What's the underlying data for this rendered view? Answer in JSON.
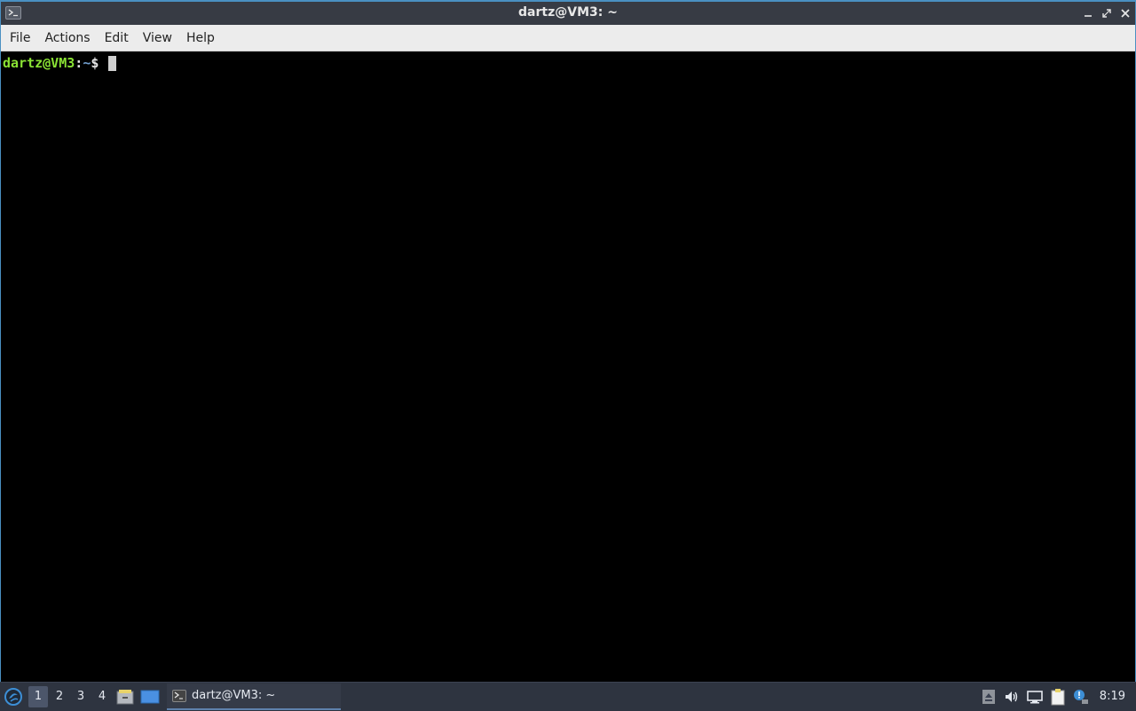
{
  "window": {
    "title": "dartz@VM3: ~"
  },
  "menubar": {
    "items": [
      {
        "label": "File"
      },
      {
        "label": "Actions"
      },
      {
        "label": "Edit"
      },
      {
        "label": "View"
      },
      {
        "label": "Help"
      }
    ]
  },
  "terminal": {
    "user_host": "dartz@VM3",
    "colon": ":",
    "path": "~",
    "dollar": "$"
  },
  "taskbar": {
    "desktops": [
      "1",
      "2",
      "3",
      "4"
    ],
    "active_desktop": "1",
    "task_label": "dartz@VM3: ~",
    "clock": "8:19"
  },
  "colors": {
    "accent": "#5e81ac",
    "prompt_user": "#8ae234",
    "prompt_path": "#729fcf"
  }
}
